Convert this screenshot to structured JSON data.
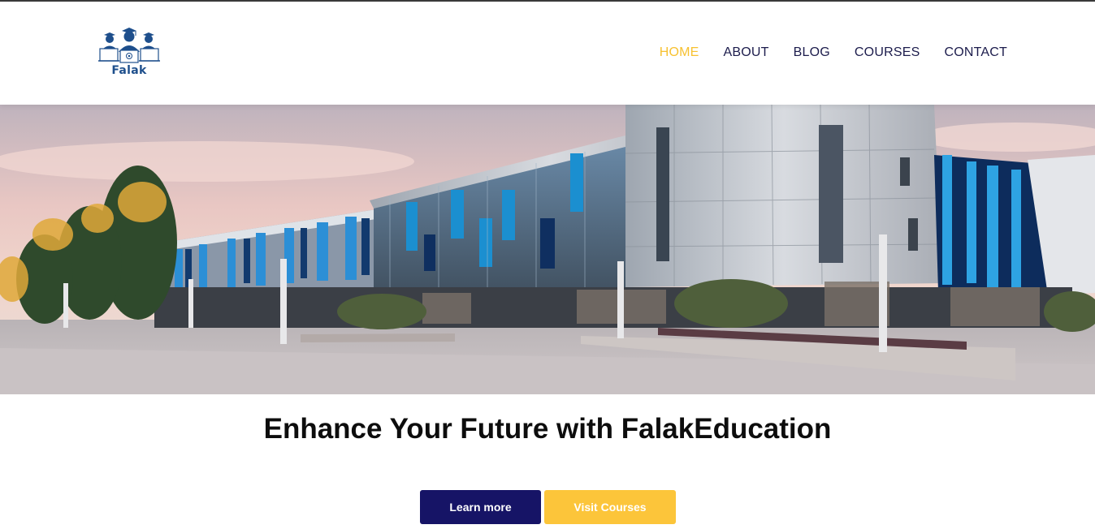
{
  "logo": {
    "text": "Falak",
    "icon": "graduates-laptop-icon"
  },
  "nav": {
    "items": [
      {
        "label": "HOME",
        "active": true
      },
      {
        "label": "ABOUT",
        "active": false
      },
      {
        "label": "BLOG",
        "active": false
      },
      {
        "label": "COURSES",
        "active": false
      },
      {
        "label": "CONTACT",
        "active": false
      }
    ]
  },
  "hero": {
    "image": "campus-building-photo",
    "headline": "Enhance Your Future with FalakEducation"
  },
  "actions": {
    "learn_more": "Learn more",
    "visit_courses": "Visit Courses"
  },
  "colors": {
    "accent": "#f7c131",
    "nav_text": "#1c1c4c",
    "primary_button": "#161466",
    "secondary_button": "#fcc53a",
    "logo_blue": "#1e4f8c"
  }
}
